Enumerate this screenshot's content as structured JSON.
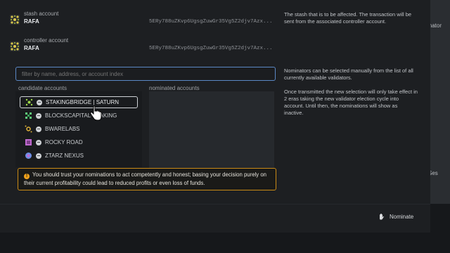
{
  "background": {
    "right_label": "inator",
    "right_label2": "Ses"
  },
  "stash": {
    "label": "stash account",
    "name": "RAFA",
    "address": "5ERy788uZKvp6UgsgZuwGr35Vg5Z2djv7Azx..."
  },
  "controller": {
    "label": "controller account",
    "name": "RAFA",
    "address": "5ERy788uZKvp6UgsgZuwGr35Vg5Z2djv7Azx..."
  },
  "help": {
    "stash": "The stash that is to be affected. The transaction will be sent from the associated controller account.",
    "nominators_1": "Nominators can be selected manually from the list of all currently available validators.",
    "nominators_2": "Once transmitted the new selection will only take effect in 2 eras taking the new validator election cycle into account. Until then, the nominations will show as inactive."
  },
  "filter": {
    "placeholder": "filter by name, address, or account index"
  },
  "columns": {
    "candidates": "candidate accounts",
    "nominated": "nominated accounts"
  },
  "candidates": [
    {
      "name": "STAKINGBRIDGE | SATURN",
      "color": "#9fd94a"
    },
    {
      "name": "BLOCKSCAPITAL-STAKING",
      "color": "#5fcf7a"
    },
    {
      "name": "BWARELABS",
      "color": "#e0b33a"
    },
    {
      "name": "ROCKY ROAD",
      "color": "#c06ad0"
    },
    {
      "name": "ZTARZ NEXUS",
      "color": "#6e8fe6"
    }
  ],
  "warning": {
    "text": "You should trust your nominations to act competently and honest; basing your decision purely on their current profitability could lead to reduced profits or even loss of funds."
  },
  "footer": {
    "nominate_label": "Nominate"
  },
  "colors": {
    "accent_border": "#5b88c6",
    "warning_border": "#c98a16",
    "warning_icon": "#f0a21b"
  }
}
